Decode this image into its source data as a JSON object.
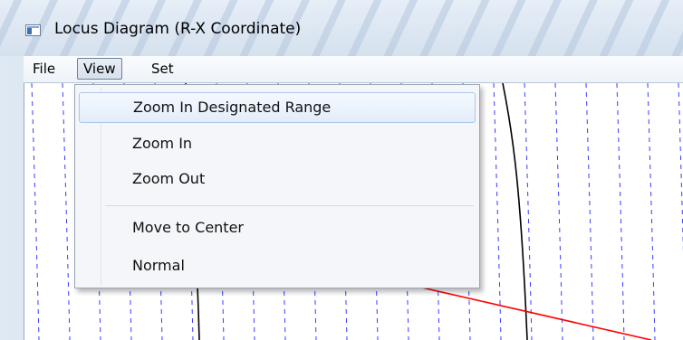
{
  "window": {
    "title": "Locus Diagram (R-X Coordinate)"
  },
  "menubar": {
    "items": [
      {
        "label": "File"
      },
      {
        "label": "View"
      },
      {
        "label": "Set"
      }
    ],
    "active": "View"
  },
  "view_menu": {
    "items": [
      {
        "label": "Zoom In Designated Range",
        "highlighted": true
      },
      {
        "label": "Zoom In"
      },
      {
        "label": "Zoom Out"
      },
      {
        "label": "Move to Center"
      },
      {
        "label": "Normal"
      }
    ]
  },
  "icons": {
    "app": "app-window-icon"
  },
  "colors": {
    "grid_lines": "#3b3bff",
    "locus_curve": "#000000",
    "impedance_line": "#ff0000"
  }
}
